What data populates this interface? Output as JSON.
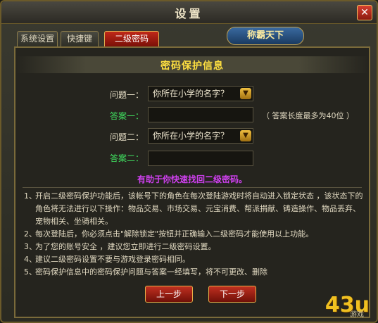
{
  "window": {
    "title": "设置",
    "close_glyph": "✕"
  },
  "tabs": [
    {
      "label": "系统设置"
    },
    {
      "label": "快捷键"
    },
    {
      "label": "二级密码"
    }
  ],
  "banner_text": "称霸天下",
  "panel": {
    "title": "密码保护信息",
    "question1_label": "问题一：",
    "question1_value": "你所在小学的名字？",
    "answer1_label": "答案一：",
    "answer_hint": "（ 答案长度最多为40位 ）",
    "question2_label": "问题二：",
    "question2_value": "你所在小学的名字？",
    "answer2_label": "答案二：",
    "helper_text": "有助于你快速找回二级密码。"
  },
  "notes": [
    {
      "num": "1、",
      "text": "开启二级密码保护功能后，该帐号下的角色在每次登陆游戏时将自动进入锁定状态 ，该状态下的角色将无法进行以下操作：物品交易、市场交易、元宝消费、帮派捐献、铸造操作、物品丢弃、宠物相关、坐骑相关。"
    },
    {
      "num": "2、",
      "text": "每次登陆后，你必须点击\"解除锁定\"按钮并正确输入二级密码才能使用以上功能。"
    },
    {
      "num": "3、",
      "text": "为了您的账号安全 ，建议您立即进行二级密码设置。"
    },
    {
      "num": "4、",
      "text": "建议二级密码设置不要与游戏登录密码相同。"
    },
    {
      "num": "5、",
      "text": "密码保护信息中的密码保护问题与答案一经填写，将不可更改、删除"
    }
  ],
  "buttons": {
    "prev": "上一步",
    "next": "下一步"
  },
  "logo": {
    "text": "43u",
    "sub": "游戏"
  },
  "colors": {
    "accent_red": "#c02818",
    "answer_green": "#40e060",
    "title_yellow": "#ffe040",
    "helper_purple": "#d040f0"
  }
}
